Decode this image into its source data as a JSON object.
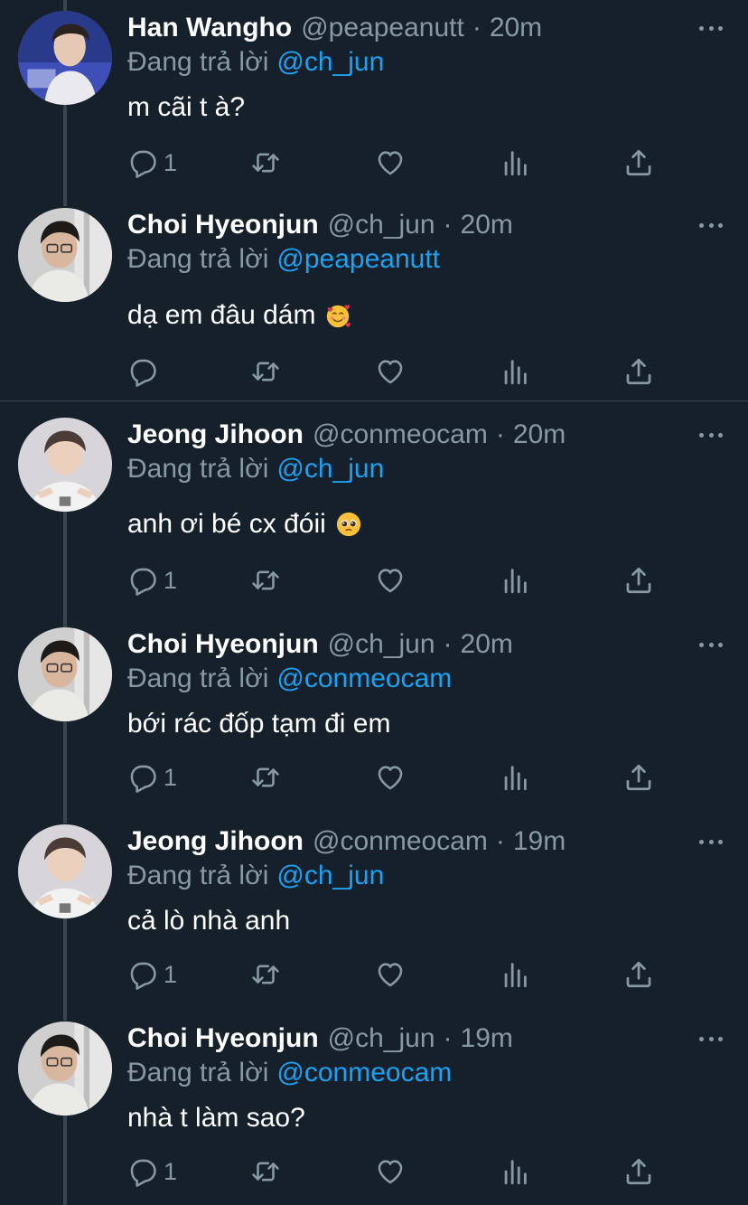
{
  "reply_prefix": "Đang trả lời",
  "colors": {
    "background": "#15202b",
    "muted": "#8899a6",
    "mention": "#1da1f2",
    "thread_line": "#38444d"
  },
  "icons": {
    "reply": "reply-icon",
    "retweet": "retweet-icon",
    "like": "heart-icon",
    "views": "bar-chart-icon",
    "share": "share-icon",
    "more": "more-icon"
  },
  "tweets": [
    {
      "name": "Han Wangho",
      "handle": "@peapeanutt",
      "sep": "·",
      "time": "20m",
      "reply_to": "@ch_jun",
      "text": "m cãi t à?",
      "reply_count": "1"
    },
    {
      "name": "Choi Hyeonjun",
      "handle": "@ch_jun",
      "sep": "·",
      "time": "20m",
      "reply_to": "@peapeanutt",
      "text": "dạ em đâu dám",
      "emoji": "smiling-face-with-hearts",
      "reply_count": ""
    },
    {
      "name": "Jeong Jihoon",
      "handle": "@conmeocam",
      "sep": "·",
      "time": "20m",
      "reply_to": "@ch_jun",
      "text": "anh ơi bé cx đóii",
      "emoji": "pleading-face",
      "reply_count": "1"
    },
    {
      "name": "Choi Hyeonjun",
      "handle": "@ch_jun",
      "sep": "·",
      "time": "20m",
      "reply_to": "@conmeocam",
      "text": "bới rác đốp tạm đi em",
      "reply_count": "1"
    },
    {
      "name": "Jeong Jihoon",
      "handle": "@conmeocam",
      "sep": "·",
      "time": "19m",
      "reply_to": "@ch_jun",
      "text": "cả lò nhà anh",
      "reply_count": "1"
    },
    {
      "name": "Choi Hyeonjun",
      "handle": "@ch_jun",
      "sep": "·",
      "time": "19m",
      "reply_to": "@conmeocam",
      "text": "nhà t làm sao?",
      "reply_count": "1"
    }
  ]
}
